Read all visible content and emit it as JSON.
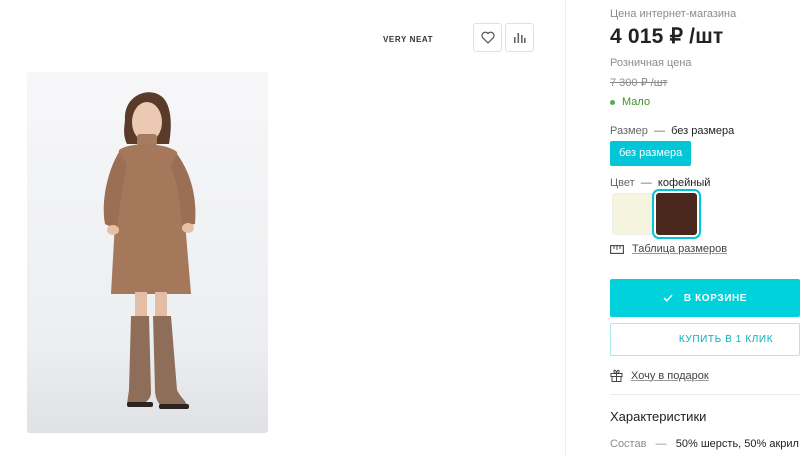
{
  "brand": "VERY NEAT",
  "icons": {
    "favorite": "heart-icon",
    "compare": "bar-chart-icon"
  },
  "pricing": {
    "online_label": "Цена интернет-магазина",
    "online_price": "4 015 ₽ /шт",
    "retail_label": "Розничная цена",
    "retail_price": "7 300 ₽ /шт",
    "stock_status": "Мало"
  },
  "size": {
    "label": "Размер",
    "separator": "—",
    "value": "без размера",
    "options": [
      "без размера"
    ]
  },
  "color": {
    "label": "Цвет",
    "separator": "—",
    "value": "кофейный",
    "swatches": [
      {
        "name": "cream",
        "hex": "#f5f5df",
        "selected": false
      },
      {
        "name": "coffee",
        "hex": "#4a271c",
        "selected": true
      }
    ]
  },
  "size_table_link": "Таблица размеров",
  "buttons": {
    "in_cart": "В КОРЗИНЕ",
    "buy_one_click": "КУПИТЬ В 1 КЛИК"
  },
  "gift_link": "Хочу в подарок",
  "characteristics": {
    "title": "Характеристики",
    "composition_label": "Состав",
    "separator": "—",
    "composition_value": "50% шерсть, 50% акрил"
  },
  "colors": {
    "accent": "#00d2dc",
    "selected_chip": "#00c6d7",
    "stock": "#4caf50"
  }
}
